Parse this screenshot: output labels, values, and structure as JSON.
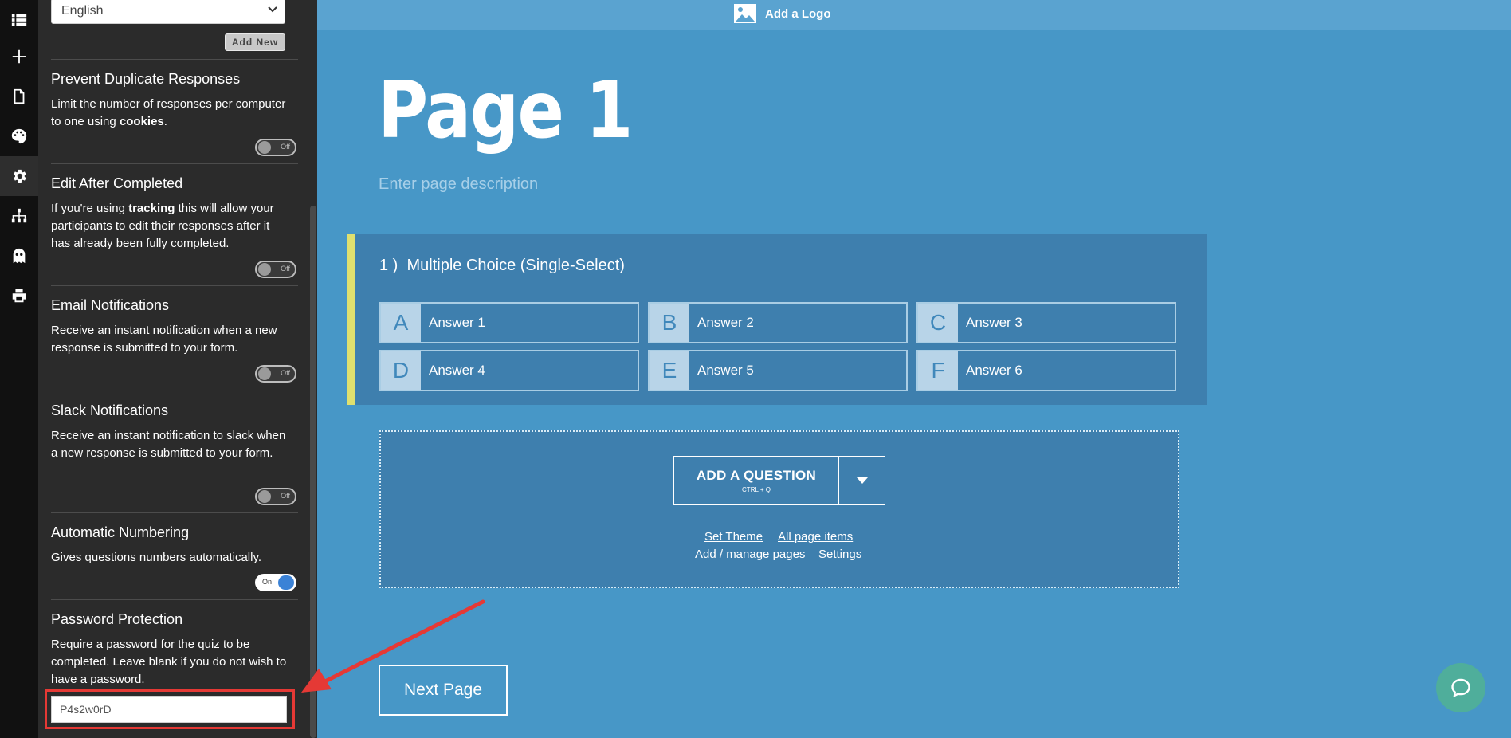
{
  "icon_rail": {
    "items": [
      {
        "name": "list-icon"
      },
      {
        "name": "plus-icon"
      },
      {
        "name": "document-icon"
      },
      {
        "name": "palette-icon"
      },
      {
        "name": "gear-icon"
      },
      {
        "name": "sitemap-icon"
      },
      {
        "name": "ghost-icon"
      },
      {
        "name": "printer-icon"
      }
    ],
    "active": "gear-icon"
  },
  "settings": {
    "language_value": "English",
    "add_new_label": "Add New",
    "sections": [
      {
        "title": "Prevent Duplicate Responses",
        "desc_parts": [
          "Limit the number of responses per computer to one using ",
          "cookies",
          "."
        ],
        "toggle": "Off"
      },
      {
        "title": "Edit After Completed",
        "desc_parts": [
          "If you're using ",
          "tracking",
          " this will allow your participants to edit their responses after it has already been fully completed."
        ],
        "toggle": "Off"
      },
      {
        "title": "Email Notifications",
        "desc": "Receive an instant notification when a new response is submitted to your form.",
        "toggle": "Off"
      },
      {
        "title": "Slack Notifications",
        "desc": "Receive an instant notification to slack when a new response is submitted to your form.",
        "toggle": "Off"
      },
      {
        "title": "Automatic Numbering",
        "desc": "Gives questions numbers automatically.",
        "toggle": "On"
      },
      {
        "title": "Password Protection",
        "desc": "Require a password for the quiz to be completed. Leave blank if you do not wish to have a password."
      }
    ],
    "password_value": "P4s2w0rD"
  },
  "canvas": {
    "logo_label": "Add a Logo",
    "page_title": "Page 1",
    "page_desc_placeholder": "Enter page description",
    "question": {
      "number": "1 )",
      "title": "Multiple Choice (Single-Select)",
      "answers": [
        {
          "letter": "A",
          "text": "Answer 1"
        },
        {
          "letter": "B",
          "text": "Answer 2"
        },
        {
          "letter": "C",
          "text": "Answer 3"
        },
        {
          "letter": "D",
          "text": "Answer 4"
        },
        {
          "letter": "E",
          "text": "Answer 5"
        },
        {
          "letter": "F",
          "text": "Answer 6"
        }
      ]
    },
    "add_question_label": "ADD A QUESTION",
    "add_question_shortcut": "CTRL + Q",
    "links": {
      "set_theme": "Set Theme",
      "all_page_items": "All page items",
      "add_manage_pages": "Add / manage pages",
      "settings": "Settings"
    },
    "next_page_label": "Next Page"
  },
  "colors": {
    "canvas_bg": "#4797c7",
    "card_bg": "#3e7fae",
    "accent_bar": "#dfe06f",
    "toggle_on": "#3b82d6",
    "highlight": "#e53935",
    "chat": "#4fae9b"
  }
}
